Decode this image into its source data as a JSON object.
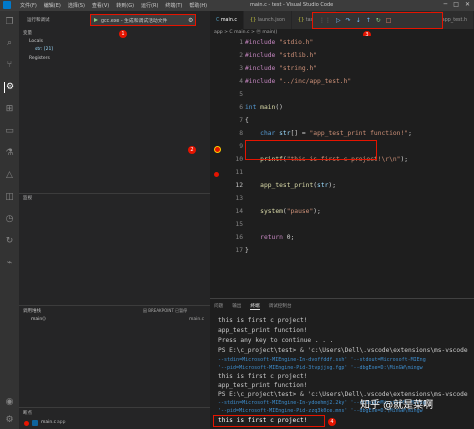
{
  "titlebar": {
    "menus": [
      "文件(F)",
      "编辑(E)",
      "选择(S)",
      "查看(V)",
      "转到(G)",
      "运行(R)",
      "终端(T)",
      "帮助(H)"
    ],
    "window_title": "main.c - test - Visual Studio Code",
    "controls": [
      "─",
      "□",
      "✕"
    ]
  },
  "sidebar": {
    "run_label": "运行和调试",
    "config_label": "gcc.exe - 生成和调试活动文件",
    "variables_header": "变量",
    "locals_label": "Locals",
    "str_var": "str: [21]",
    "registers_label": "Registers",
    "watch_header": "监视",
    "callstack_header": "调用堆栈",
    "callstack_state": "因 BREAKPOINT 已暂停",
    "callstack_frame": "main()",
    "callstack_file": "main.c",
    "breakpoints_header": "断点",
    "breakpoint_file": "main.c",
    "breakpoint_dir": "app"
  },
  "editor": {
    "tabs": [
      "main.c",
      "launch.json",
      "tasks.json",
      "app_test.h"
    ],
    "breadcrumb": "app > C main.c > ⓜ main()",
    "lines": [
      {
        "n": "1",
        "t": "#include \"stdio.h\""
      },
      {
        "n": "2",
        "t": "#include \"stdlib.h\""
      },
      {
        "n": "3",
        "t": "#include \"string.h\""
      },
      {
        "n": "4",
        "t": "#include \"../inc/app_test.h\""
      },
      {
        "n": "5",
        "t": ""
      },
      {
        "n": "6",
        "t": "int main()"
      },
      {
        "n": "7",
        "t": "{"
      },
      {
        "n": "8",
        "t": "    char str[] = \"app_test_print function!\";"
      },
      {
        "n": "9",
        "t": ""
      },
      {
        "n": "10",
        "t": "    printf(\"this is first c project!\\r\\n\");"
      },
      {
        "n": "11",
        "t": ""
      },
      {
        "n": "12",
        "t": "    app_test_print(str);"
      },
      {
        "n": "13",
        "t": ""
      },
      {
        "n": "14",
        "t": "    system(\"pause\");"
      },
      {
        "n": "15",
        "t": ""
      },
      {
        "n": "16",
        "t": "    return 0;"
      },
      {
        "n": "17",
        "t": "}"
      }
    ]
  },
  "panel": {
    "tabs": [
      "问题",
      "输出",
      "终端",
      "调试控制台"
    ],
    "terminal": [
      "this is first c project!",
      "app_test_print function!",
      "Press any key to continue . . .",
      "PS E:\\c_project\\test> & 'c:\\Users\\Dell\\.vscode\\extensions\\ms-vscode",
      "--stdin=Microsoft-MIEngine-In-dvoffddf.ssh' '--stdout=Microsoft-MIEng",
      "'--pid=Microsoft-MIEngine-Pid-3tvpjjsg.fgp' '--dbgExe=D:\\MinGW\\mingw",
      "this is first c project!",
      "app_test_print function!",
      "PS E:\\c_project\\test> & 'c:\\Users\\Dell\\.vscode\\extensions\\ms-vscode",
      "--stdin=Microsoft-MIEngine-In-ydoehmj2.2ky' '--stdout=Microsoft-MIEng",
      "'--pid=Microsoft-MIEngine-Pid-zzq3k0ce.mns' '--dbgExe=D:\\MinGW\\mingw",
      "this is first c project!"
    ]
  },
  "callouts": [
    "1",
    "2",
    "3",
    "4"
  ],
  "watermark": "知乎 @就是菜啊",
  "colors": {
    "accent_red": "#e51400",
    "highlight": "#4b4b18",
    "breakpoint": "#e51400"
  }
}
